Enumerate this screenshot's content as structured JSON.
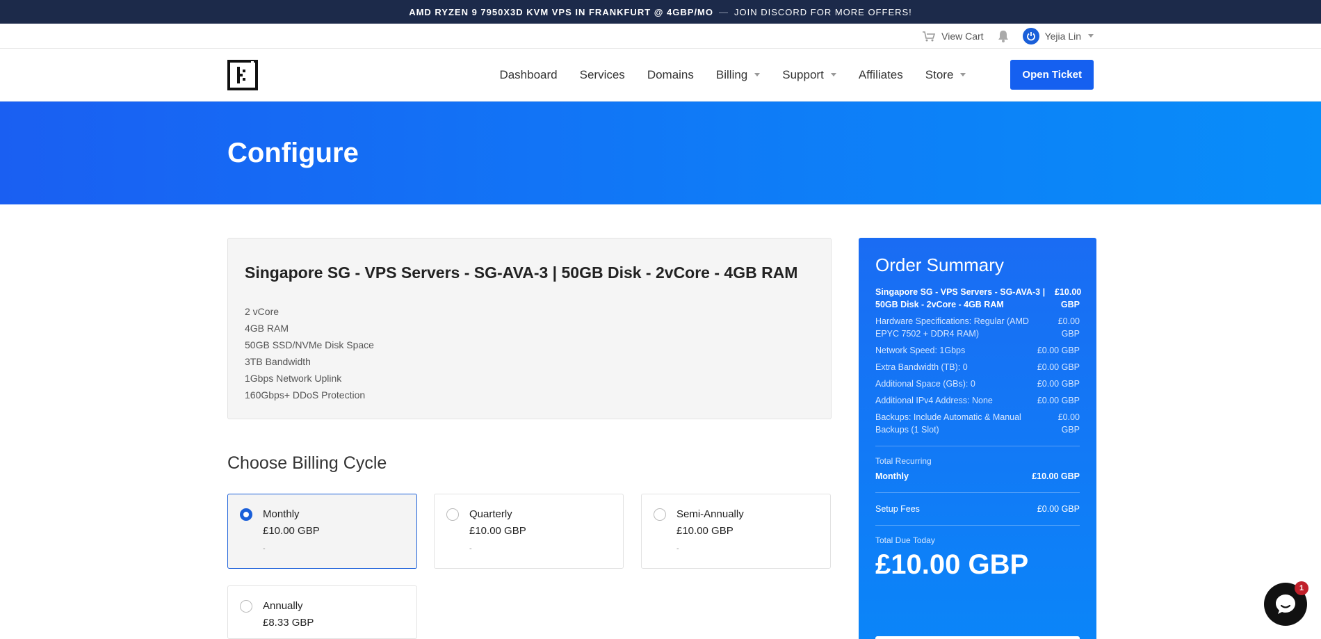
{
  "announcement": {
    "highlight": "AMD RYZEN 9 7950X3D KVM VPS IN FRANKFURT @ 4GBP/MO",
    "separator": "—",
    "rest": "JOIN DISCORD FOR MORE OFFERS!"
  },
  "utility": {
    "cart_label": "View Cart",
    "user_name": "Yejia Lin"
  },
  "nav": {
    "items": [
      "Dashboard",
      "Services",
      "Domains",
      "Billing",
      "Support",
      "Affiliates",
      "Store"
    ],
    "open_ticket": "Open Ticket"
  },
  "hero": {
    "title": "Configure"
  },
  "product": {
    "title": "Singapore SG - VPS Servers - SG-AVA-3 | 50GB Disk - 2vCore - 4GB RAM",
    "specs": [
      "2 vCore",
      "4GB RAM",
      "50GB SSD/NVMe Disk Space",
      "3TB Bandwidth",
      "1Gbps Network Uplink",
      "160Gbps+ DDoS Protection"
    ]
  },
  "billing": {
    "heading": "Choose Billing Cycle",
    "cycles": [
      {
        "name": "Monthly",
        "price": "£10.00 GBP",
        "note": "-",
        "selected": true
      },
      {
        "name": "Quarterly",
        "price": "£10.00 GBP",
        "note": "-",
        "selected": false
      },
      {
        "name": "Semi-Annually",
        "price": "£10.00 GBP",
        "note": "-",
        "selected": false
      },
      {
        "name": "Annually",
        "price": "£8.33 GBP",
        "note": "",
        "selected": false
      }
    ]
  },
  "summary": {
    "title": "Order Summary",
    "product_name": "Singapore SG - VPS Servers - SG-AVA-3 | 50GB Disk - 2vCore - 4GB RAM",
    "product_price": "£10.00 GBP",
    "options": [
      {
        "label": "Hardware Specifications: Regular (AMD EPYC 7502 + DDR4 RAM)",
        "value": "£0.00 GBP"
      },
      {
        "label": "Network Speed: 1Gbps",
        "value": "£0.00 GBP"
      },
      {
        "label": "Extra Bandwidth (TB): 0",
        "value": "£0.00 GBP"
      },
      {
        "label": "Additional Space (GBs): 0",
        "value": "£0.00 GBP"
      },
      {
        "label": "Additional IPv4 Address: None",
        "value": "£0.00 GBP"
      },
      {
        "label": "Backups: Include Automatic & Manual Backups (1 Slot)",
        "value": "£0.00 GBP"
      }
    ],
    "recurring_label": "Total Recurring",
    "recurring_cycle": "Monthly",
    "recurring_value": "£10.00 GBP",
    "setup_label": "Setup Fees",
    "setup_value": "£0.00 GBP",
    "due_label": "Total Due Today",
    "due_value": "£10.00 GBP"
  },
  "chat": {
    "badge": "1"
  }
}
